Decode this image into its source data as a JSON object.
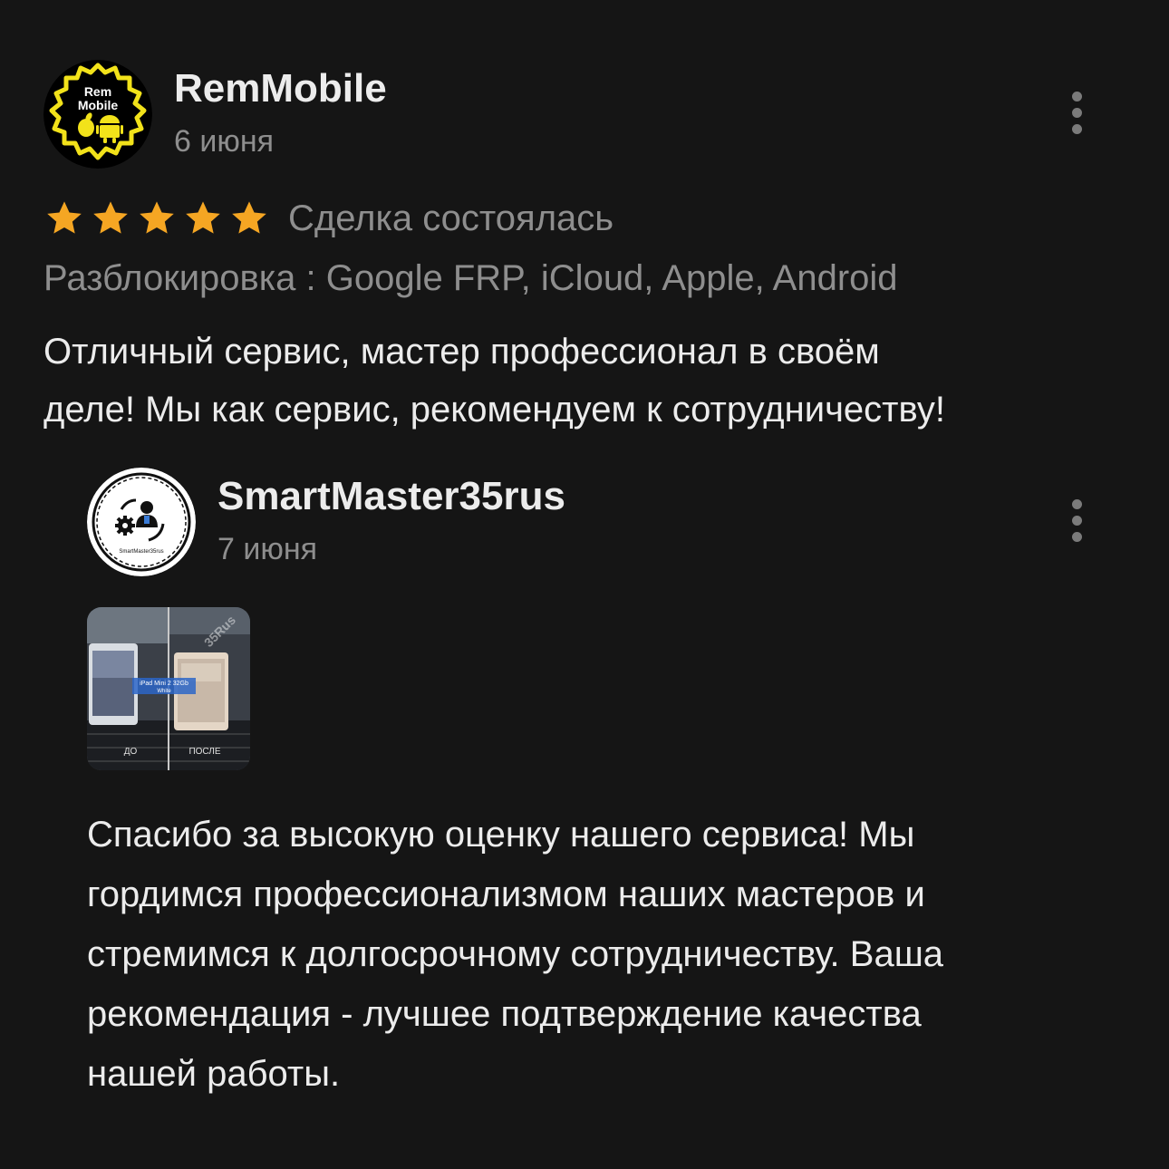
{
  "review": {
    "author": {
      "name": "RemMobile",
      "date": "6 июня",
      "avatar_text_line1": "Rem",
      "avatar_text_line2": "Mobile"
    },
    "rating": 5,
    "rating_max": 5,
    "status": "Сделка состоялась",
    "category": "Разблокировка : Google FRP, iCloud, Apple, Android",
    "text_lines": [
      "Отличный сервис, мастер профессионал в своём",
      "деле! Мы как сервис, рекомендуем к сотрудничеству!"
    ],
    "menu_icon": "more-vertical-icon"
  },
  "reply": {
    "author": {
      "name": "SmartMaster35rus",
      "date": "7 июня",
      "avatar_caption": "SmartMaster35rus"
    },
    "photo": {
      "label_left": "ДО",
      "label_right": "ПОСЛЕ",
      "watermark": "35Rus",
      "device_label_line1": "iPad Mini 2 32Gb",
      "device_label_line2": "White"
    },
    "text_lines": [
      "Спасибо за высокую оценку нашего сервиса! Мы",
      "гордимся профессионализмом наших мастеров и",
      "стремимся к долгосрочному сотрудничеству. Ваша",
      "рекомендация - лучшее подтверждение качества",
      "нашей работы."
    ],
    "menu_icon": "more-vertical-icon"
  },
  "colors": {
    "background": "#151515",
    "star": "#f5a623",
    "primary_text": "#ececec",
    "secondary_text": "#8e8e8e",
    "logo_yellow": "#f2e21a"
  }
}
